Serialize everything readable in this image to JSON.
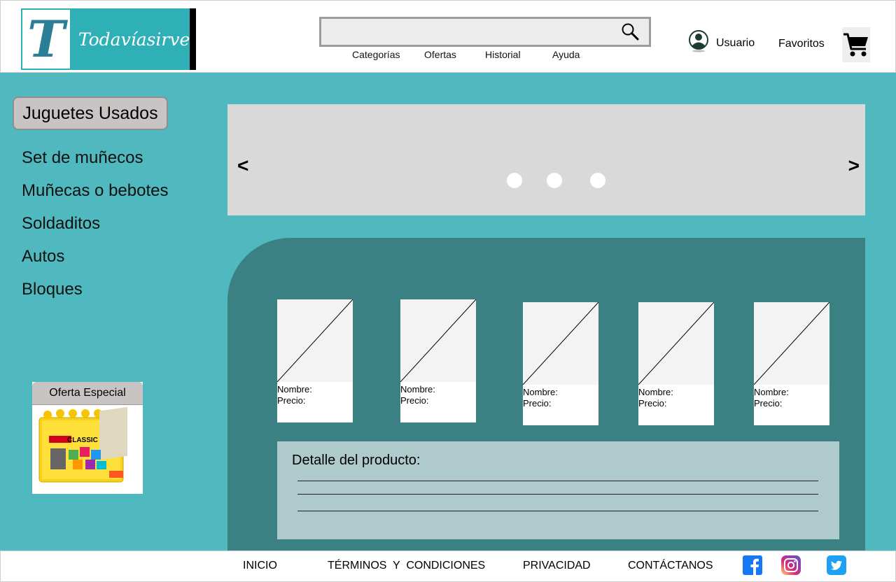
{
  "header": {
    "logo_letter": "T",
    "logo_text": "Todavíasirve",
    "search": {
      "placeholder": ""
    },
    "nav": [
      "Categorías",
      "Ofertas",
      "Historial",
      "Ayuda"
    ],
    "user_label": "Usuario",
    "favorites_label": "Favoritos"
  },
  "sidebar": {
    "category_button": "Juguetes Usados",
    "items": [
      "Set de muñecos",
      "Muñecas o bebotes",
      "Soldaditos",
      "Autos",
      "Bloques"
    ],
    "offer": {
      "title": "Oferta Especial",
      "image_text": "CLASSIC"
    }
  },
  "carousel": {
    "prev": "<",
    "next": ">",
    "dots": 3
  },
  "products": {
    "cards": [
      {
        "name_label": "Nombre:",
        "price_label": "Precio:"
      },
      {
        "name_label": "Nombre:",
        "price_label": "Precio:"
      },
      {
        "name_label": "Nombre:",
        "price_label": "Precio:"
      },
      {
        "name_label": "Nombre:",
        "price_label": "Precio:"
      },
      {
        "name_label": "Nombre:",
        "price_label": "Precio:"
      }
    ],
    "detail_title": "Detalle del producto:"
  },
  "footer": {
    "links": [
      "INICIO",
      "TÉRMINOS  Y  CONDICIONES",
      "PRIVACIDAD",
      "CONTÁCTANOS"
    ],
    "social": [
      "facebook-icon",
      "instagram-icon",
      "twitter-icon"
    ]
  },
  "colors": {
    "page_bg": "#4fb9bf",
    "panel_bg": "#3b8184",
    "detail_bg": "#afcacb",
    "logo_bg": "#2fb0b6"
  }
}
